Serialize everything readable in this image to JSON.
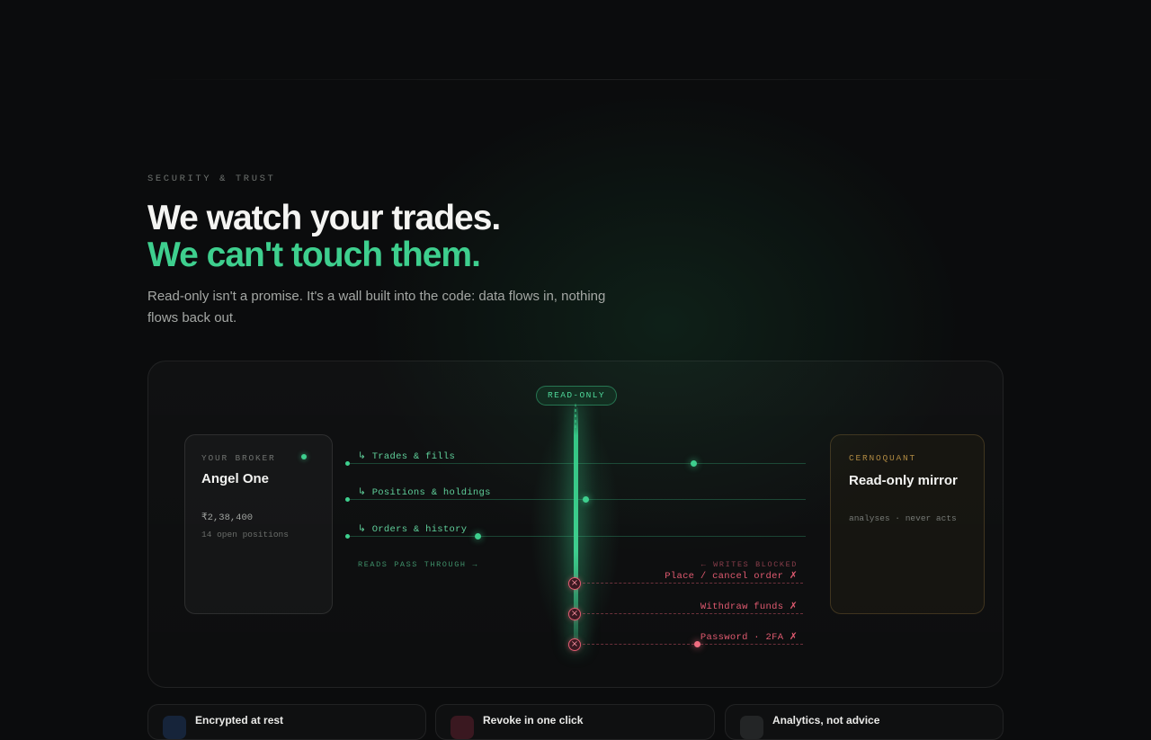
{
  "section": {
    "eyebrow": "SECURITY & TRUST",
    "headline_line1": "We watch your trades.",
    "headline_line2": "We can't touch them.",
    "lede": "Read-only isn't a promise. It's a wall built into the code: data flows in, nothing flows back out."
  },
  "diagram": {
    "badge": "READ-ONLY",
    "broker": {
      "kicker": "YOUR BROKER",
      "name": "Angel One",
      "balance": "₹2,38,400",
      "positions": "14 open positions"
    },
    "mirror": {
      "kicker": "CERNOQUANT",
      "name": "Read-only mirror",
      "tagline": "analyses · never acts"
    },
    "reads": [
      {
        "label": "↳ Trades & fills"
      },
      {
        "label": "↳ Positions & holdings"
      },
      {
        "label": "↳ Orders & history"
      }
    ],
    "reads_caption": "READS PASS THROUGH →",
    "writes_caption": "← WRITES BLOCKED",
    "writes": [
      {
        "label": "Place / cancel order ✗"
      },
      {
        "label": "Withdraw funds ✗"
      },
      {
        "label": "Password · 2FA ✗"
      }
    ]
  },
  "features": [
    {
      "title": "Encrypted at rest"
    },
    {
      "title": "Revoke in one click"
    },
    {
      "title": "Analytics, not advice"
    }
  ],
  "colors": {
    "accent_green": "#3ecf8e",
    "blocked_red": "#e05a70",
    "mirror_gold": "#b08a42",
    "background": "#0b0c0d"
  }
}
